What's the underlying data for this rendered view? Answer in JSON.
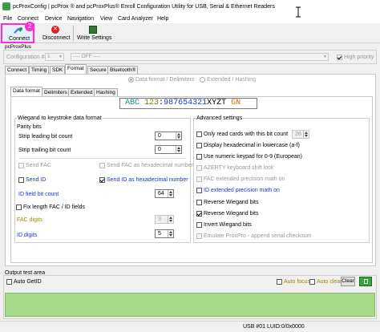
{
  "window": {
    "title": "pcProxConfig | pcProx ® and pcProxPlus® Enroll Configuration Utility for USB, Serial & Ethernet Readers"
  },
  "menu": [
    "File",
    "Connect",
    "Device",
    "Navigation",
    "View",
    "Card Analyzer",
    "Help"
  ],
  "toolbar": {
    "connect": "Connect",
    "disconnect": "Disconnect",
    "write": "Write Settings",
    "badge": "2"
  },
  "device": {
    "group": "pcProxPlus",
    "config_label": "Configuration #",
    "config_value": "1",
    "off_value": "---- OFF ----",
    "high_priority": "High priority"
  },
  "main_tabs": [
    "Connect",
    "Timing",
    "SDK",
    "Format",
    "Secure",
    "Bluetooth®"
  ],
  "radios": {
    "format_delims": "Data format / Delimiters",
    "ext_hash": "Extended / Hashing"
  },
  "sub_tabs": [
    "Data format",
    "Delimiters",
    "Extended",
    "Hashing"
  ],
  "preview": {
    "abc": "ABC",
    "num": "123",
    "colon": ":",
    "id": "987654321",
    "xyz": "XYZT",
    "gn": "GN"
  },
  "wiegand": {
    "title": "Wiegand to keystroke data format",
    "parity_label": "Parity bits",
    "strip_leading": "Strip leading bit count",
    "strip_leading_val": "0",
    "strip_trailing": "Strip trailing bit count",
    "strip_trailing_val": "0",
    "send_fac": "Send FAC",
    "send_fac_hex": "Send FAC as hexadecimal number",
    "send_id": "Send ID",
    "send_id_hex": "Send ID as hexadecimal number",
    "id_field": "ID field bit count",
    "id_field_val": "64",
    "fix_length": "Fix length FAC / ID fields",
    "fac_digits": "FAC digits",
    "fac_digits_val": "3",
    "id_digits": "ID digits",
    "id_digits_val": "5"
  },
  "advanced": {
    "title": "Advanced settings",
    "only_read": "Only read cards with this bit count",
    "only_read_val": "26",
    "display_hex": "Display hexadecimal in lowercase (a-f)",
    "numeric_keypad": "Use numeric keypad for 0-9 (European)",
    "azerty": "AZERTY keyboard shift lock",
    "fac_extended": "FAC extended precision math on",
    "id_extended": "ID extended precision math on",
    "reverse_wiegand": "Reverse Wiegand bits",
    "reverse_wiegand_bits": "Reverse Wiegand bits",
    "invert_wiegand": "Invert Wiegand bits",
    "emulate": "Emulate ProxPro - append serial checksum"
  },
  "output": {
    "label": "Output test area",
    "auto_getid": "Auto GetID",
    "auto_focus": "Auto focus",
    "auto_clear": "Auto clear",
    "clear_btn": "Clear"
  },
  "status": {
    "text": "USB #01 LUID:0/0x0000"
  }
}
